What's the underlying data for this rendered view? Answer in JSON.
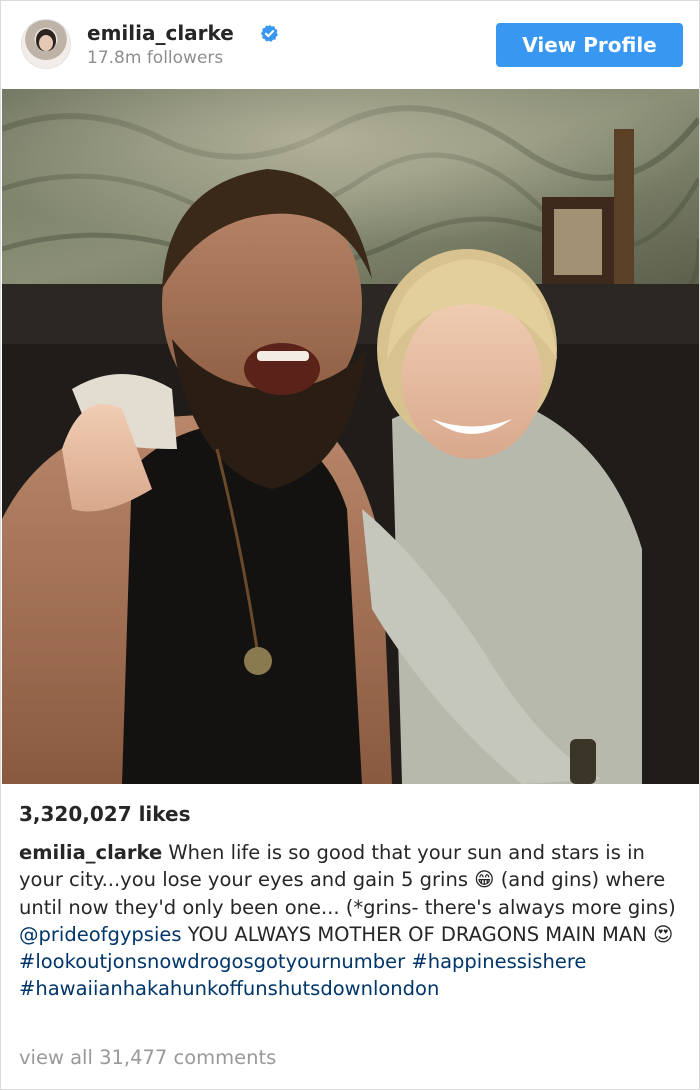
{
  "header": {
    "username": "emilia_clarke",
    "followers": "17.8m followers",
    "view_profile_label": "View Profile"
  },
  "post": {
    "image_alt": "Photo",
    "likes": "3,320,027 likes",
    "caption": {
      "author": "emilia_clarke",
      "text_1": " When life is so good that your sun and stars is in your city...you lose your eyes and gain 5 grins 😁 (and gins) where until now they'd only been one... (*grins- there's always more gins)    ",
      "mention": "@prideofgypsies",
      "text_2": " YOU ALWAYS MOTHER OF DRAGONS MAIN MAN 😍 ",
      "hashtag_1": "#lookoutjonsnowdrogosgotyournumber",
      "hashtag_2": "#happinessishere",
      "hashtag_3": "#hawaiianhakahunkoffunshutsdownlondon"
    },
    "view_comments": "view all 31,477 comments"
  },
  "colors": {
    "accent": "#3897f0",
    "link": "#003569",
    "muted": "#8e8e8e"
  },
  "icons": {
    "verified": "verified-badge-icon"
  }
}
